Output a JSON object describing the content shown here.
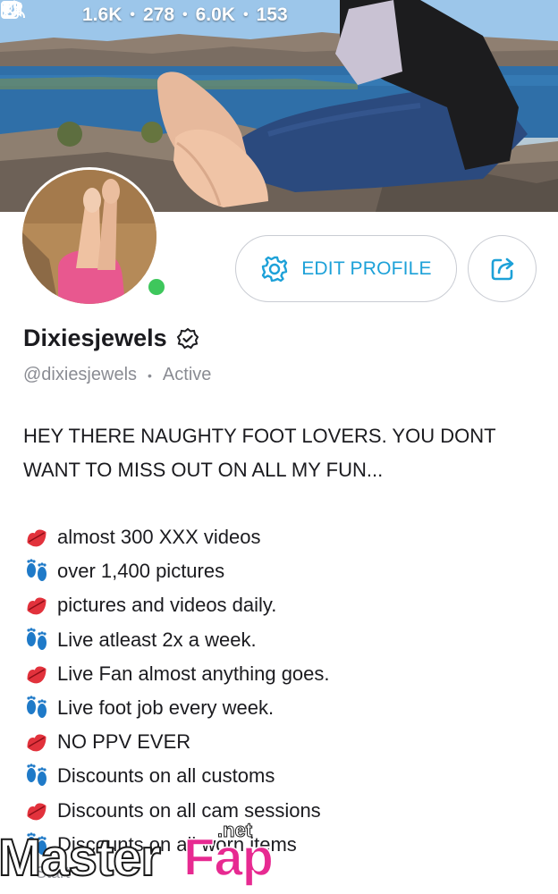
{
  "header": {
    "stats": [
      {
        "icon": "image-icon",
        "value": "1.6K"
      },
      {
        "icon": "video-icon",
        "value": "278"
      },
      {
        "icon": "heart-icon",
        "value": "6.0K"
      },
      {
        "icon": "fans-icon",
        "value": "153"
      }
    ],
    "separator": "•"
  },
  "profile": {
    "display_name": "Dixiesjewels",
    "handle": "@dixiesjewels",
    "status": "Active",
    "status_separator": "•",
    "online_color": "#3ec75c"
  },
  "actions": {
    "edit_profile_label": "EDIT PROFILE",
    "accent_color": "#1da1d8"
  },
  "bio": {
    "intro": [
      "HEY THERE NAUGHTY FOOT LOVERS. YOU DONT",
      "WANT TO MISS OUT ON ALL MY FUN..."
    ],
    "items": [
      {
        "emoji": "kiss-lips-icon",
        "text": "almost 300 XXX videos"
      },
      {
        "emoji": "footprints-icon",
        "text": "over 1,400 pictures"
      },
      {
        "emoji": "kiss-lips-icon",
        "text": "pictures and videos daily."
      },
      {
        "emoji": "footprints-icon",
        "text": "Live atleast 2x a week."
      },
      {
        "emoji": "kiss-lips-icon",
        "text": "Live Fan almost anything goes."
      },
      {
        "emoji": "footprints-icon",
        "text": "Live foot job every week."
      },
      {
        "emoji": "kiss-lips-icon",
        "text": "NO PPV EVER"
      },
      {
        "emoji": "footprints-icon",
        "text": "Discounts on all customs"
      },
      {
        "emoji": "kiss-lips-icon",
        "text": "Discounts on all cam sessions"
      },
      {
        "emoji": "footprints-icon",
        "text": "Discounts on all worn items"
      }
    ],
    "cut_off_text": "Start"
  },
  "watermark": {
    "part1": "Master",
    "part2": "Fap",
    "part3": ".net"
  }
}
